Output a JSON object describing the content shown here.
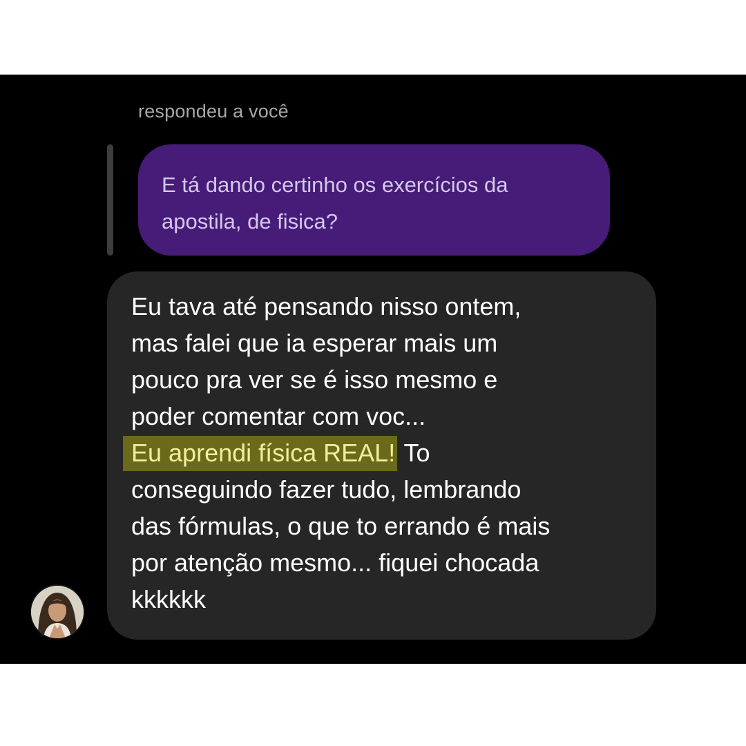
{
  "reply_label": "respondeu a você",
  "quoted_message": {
    "line1": "E tá dando certinho os exercícios da",
    "line2": "apostila, de fisica?"
  },
  "message": {
    "line1": "Eu tava até pensando nisso ontem,",
    "line2": "mas falei que ia esperar mais um",
    "line3": "pouco pra ver se é isso mesmo e",
    "line4": "poder comentar com voc...",
    "line5_highlight": "Eu aprendi física REAL!",
    "line5_rest": " To",
    "line6": "conseguindo fazer tudo, lembrando",
    "line7": "das fórmulas, o que to errando é mais",
    "line8": "por atenção mesmo... fiquei chocada",
    "line9": "kkkkkk"
  },
  "colors": {
    "quoted_bubble": "#471c78",
    "message_bubble": "#262626",
    "highlight": "#6b6a1a"
  }
}
